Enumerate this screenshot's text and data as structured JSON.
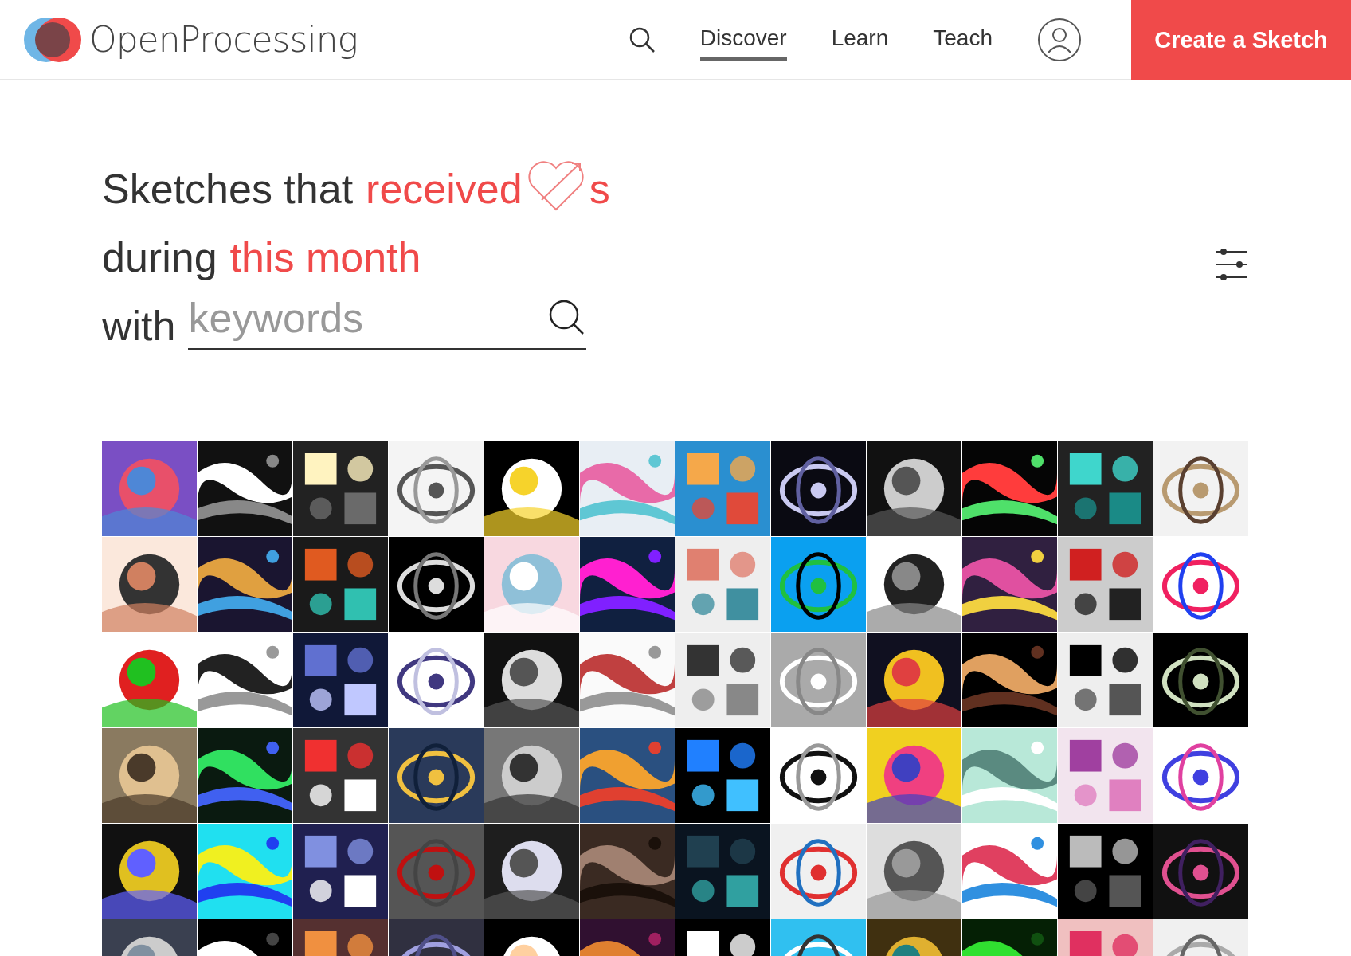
{
  "header": {
    "brand": "OpenProcessing",
    "nav": [
      {
        "label": "Discover",
        "selected": true
      },
      {
        "label": "Learn",
        "selected": false
      },
      {
        "label": "Teach",
        "selected": false
      }
    ],
    "cta": "Create a Sketch"
  },
  "headline": {
    "line1": {
      "prefix": "Sketches that",
      "link": "received",
      "suffix": "s"
    },
    "line2": {
      "prefix": "during",
      "link": "this month"
    },
    "line3": {
      "prefix": "with",
      "placeholder": "keywords"
    }
  }
}
